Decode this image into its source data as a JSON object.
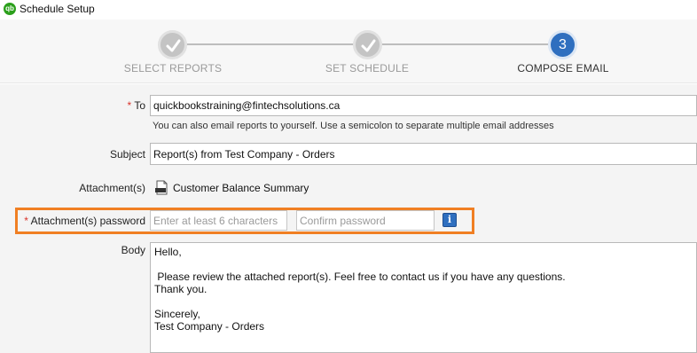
{
  "window": {
    "title": "Schedule Setup",
    "app_icon_text": "qb"
  },
  "wizard": {
    "steps": [
      {
        "label": "SELECT REPORTS",
        "state": "done"
      },
      {
        "label": "SET SCHEDULE",
        "state": "done"
      },
      {
        "label": "COMPOSE EMAIL",
        "state": "current",
        "number": "3"
      }
    ]
  },
  "form": {
    "to": {
      "required_mark": "*",
      "label": "To",
      "value": "quickbookstraining@fintechsolutions.ca",
      "hint": "You can also email reports to yourself. Use a semicolon to separate multiple email addresses"
    },
    "subject": {
      "label": "Subject",
      "value": "Report(s) from Test Company - Orders"
    },
    "attachments": {
      "label": "Attachment(s)",
      "file_icon": "pdf-file-icon",
      "file_name": "Customer Balance Summary"
    },
    "password": {
      "required_mark": "*",
      "label": "Attachment(s) password",
      "placeholder": "Enter at least 6 characters",
      "confirm_placeholder": "Confirm password",
      "info_icon": "info-icon",
      "info_glyph": "i"
    },
    "body": {
      "label": "Body",
      "value": "Hello,\n\n Please review the attached report(s). Feel free to contact us if you have any questions.\nThank you.\n\nSincerely,\nTest Company - Orders"
    }
  },
  "colors": {
    "highlight": "#f07f23",
    "accent": "#2f6fbf",
    "required": "#d9342b"
  }
}
